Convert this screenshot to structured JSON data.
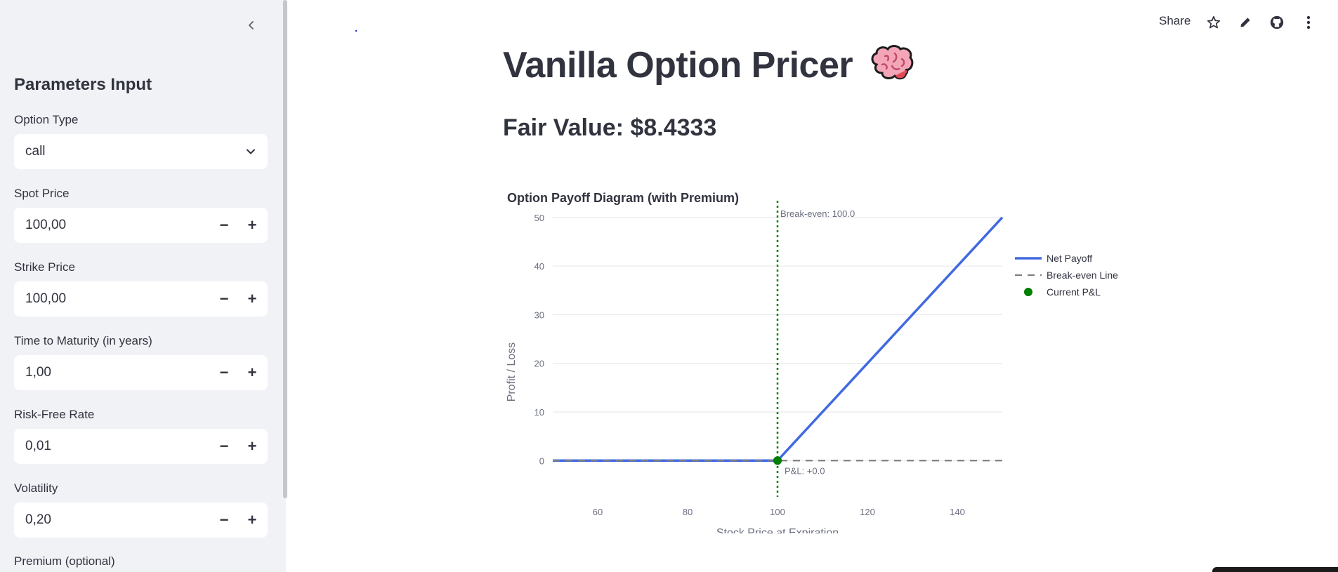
{
  "sidebar": {
    "title": "Parameters Input",
    "option_type": {
      "label": "Option Type",
      "value": "call"
    },
    "spot_price": {
      "label": "Spot Price",
      "value": "100,00"
    },
    "strike_price": {
      "label": "Strike Price",
      "value": "100,00"
    },
    "time_to_maturity": {
      "label": "Time to Maturity (in years)",
      "value": "1,00"
    },
    "risk_free_rate": {
      "label": "Risk-Free Rate",
      "value": "0,01"
    },
    "volatility": {
      "label": "Volatility",
      "value": "0,20"
    },
    "premium": {
      "label": "Premium (optional)"
    },
    "minus_glyph": "−",
    "plus_glyph": "+"
  },
  "toolbar": {
    "share_label": "Share",
    "icons": [
      "star-icon",
      "pencil-icon",
      "github-icon",
      "more-vertical-icon"
    ]
  },
  "main": {
    "title": "Vanilla Option Pricer",
    "title_emoji": "brain-icon",
    "fair_value": "Fair Value: $8.4333"
  },
  "colors": {
    "sidebar_bg": "#f0f2f6",
    "text": "#31333f",
    "net_payoff": "#4169e1",
    "breakeven_line": "#808080",
    "breakeven_vline": "#008000",
    "current_pl": "#008000"
  },
  "chart_data": {
    "type": "line",
    "title": "Option Payoff Diagram (with Premium)",
    "xlabel": "Stock Price at Expiration",
    "ylabel": "Profit / Loss",
    "xlim": [
      50,
      150
    ],
    "ylim": [
      -4,
      52
    ],
    "x_ticks": [
      60,
      80,
      100,
      120,
      140
    ],
    "y_ticks": [
      0,
      10,
      20,
      30,
      40,
      50
    ],
    "grid": "horizontal",
    "legend_position": "top-right",
    "series": [
      {
        "name": "Net Payoff",
        "style": "solid",
        "color": "#4169e1",
        "x": [
          50,
          100,
          150
        ],
        "y": [
          0,
          0,
          50
        ]
      },
      {
        "name": "Break-even Line",
        "style": "dashed",
        "color": "#808080",
        "x": [
          50,
          150
        ],
        "y": [
          0,
          0
        ]
      },
      {
        "name": "Current P&L",
        "style": "marker",
        "color": "#008000",
        "x": [
          100
        ],
        "y": [
          0
        ]
      }
    ],
    "vline": {
      "x": 100,
      "color": "#008000",
      "style": "dotted"
    },
    "annotations": [
      {
        "text": "Break-even: 100.0",
        "x": 100,
        "y": 50
      },
      {
        "text": "P&L: +0.0",
        "x": 100,
        "y": 0
      }
    ]
  }
}
